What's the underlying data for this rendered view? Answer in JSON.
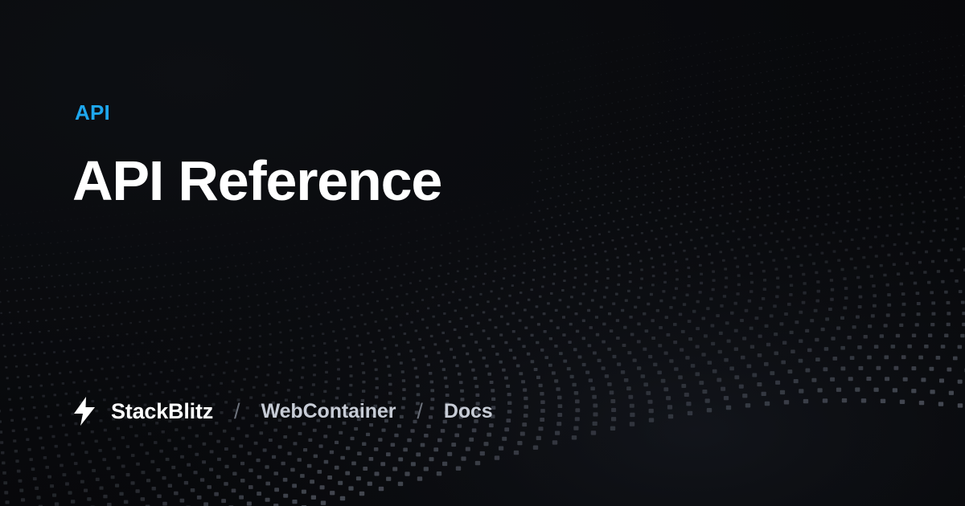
{
  "header": {
    "eyebrow": "API",
    "title": "API Reference"
  },
  "breadcrumb": {
    "brand": "StackBlitz",
    "separator": "/",
    "items": [
      "WebContainer",
      "Docs"
    ]
  },
  "icons": {
    "logo": "lightning-bolt-icon",
    "background": "dot-wave-pattern"
  },
  "colors": {
    "background": "#0a0b0e",
    "accent": "#1ea7ee",
    "title": "#ffffff",
    "breadcrumb_text": "#c7ccd6",
    "separator": "#6d727c"
  }
}
